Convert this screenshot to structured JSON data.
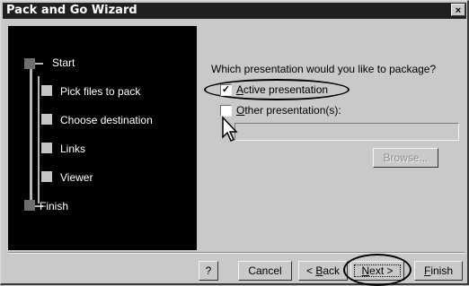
{
  "window": {
    "title": "Pack and Go Wizard",
    "close_glyph": "×"
  },
  "steps": [
    {
      "label": "Start",
      "marker": "dark"
    },
    {
      "label": "Pick files to pack",
      "marker": "light"
    },
    {
      "label": "Choose destination",
      "marker": "light"
    },
    {
      "label": "Links",
      "marker": "light"
    },
    {
      "label": "Viewer",
      "marker": "light"
    },
    {
      "label": "Finish",
      "marker": "dark"
    }
  ],
  "content": {
    "question": "Which presentation would you like to package?",
    "options": [
      {
        "label_prefix": "",
        "label_accel": "A",
        "label_rest": "ctive presentation",
        "checked": true
      },
      {
        "label_prefix": "",
        "label_accel": "O",
        "label_rest": "ther presentation(s):",
        "checked": false
      }
    ],
    "path_value": "",
    "browse_label": "Browse..."
  },
  "buttons": {
    "help": "?",
    "cancel": "Cancel",
    "back_prefix": "< ",
    "back_accel": "B",
    "back_rest": "ack",
    "next_accel": "N",
    "next_rest": "ext >",
    "finish_accel": "F",
    "finish_rest": "inish"
  },
  "colors": {
    "titlebar": "#202020",
    "left_panel": "#000000",
    "dialog_bg": "#c9c9c9"
  }
}
